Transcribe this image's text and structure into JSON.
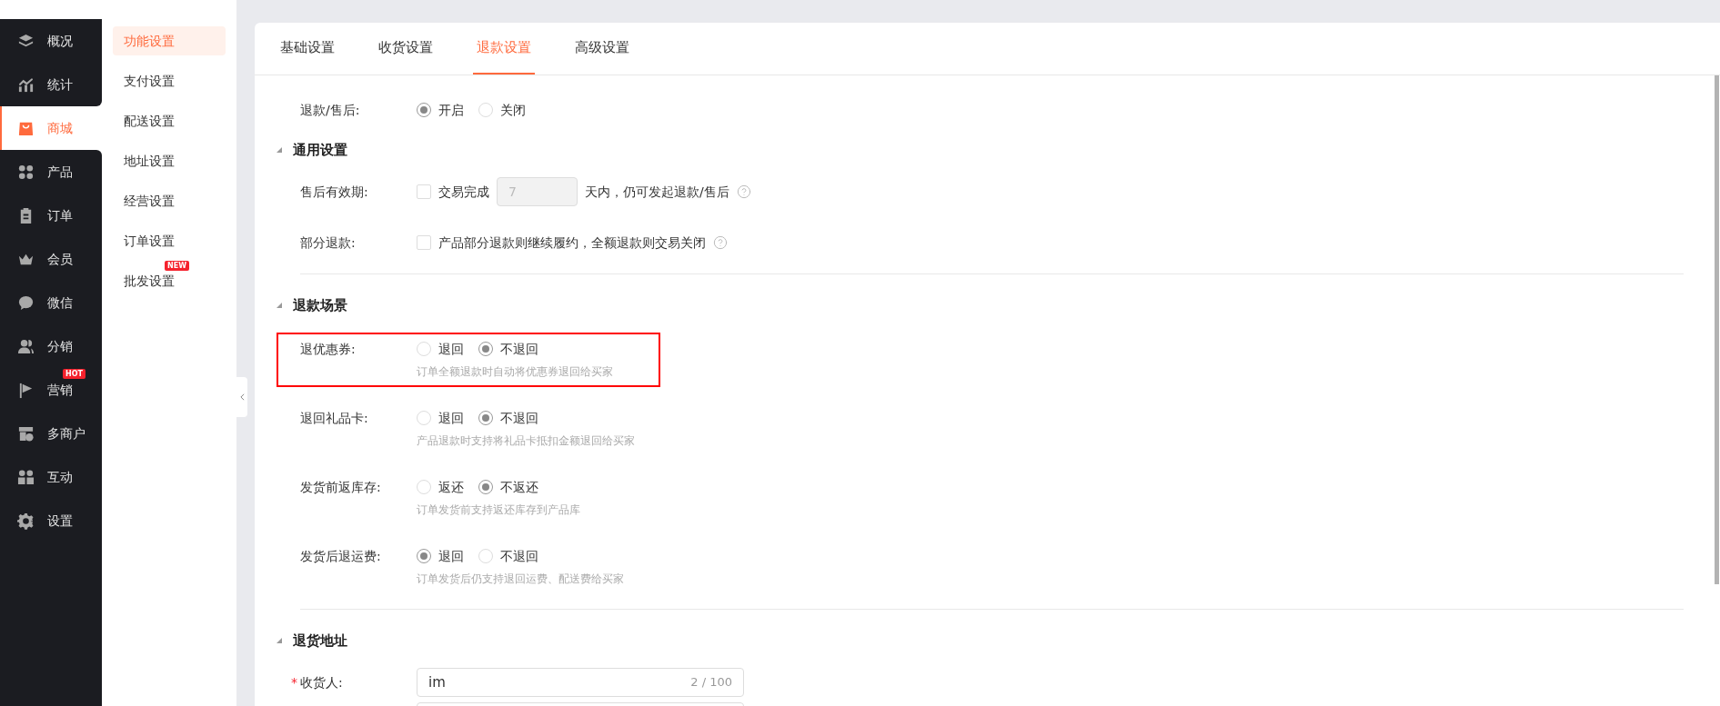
{
  "sidebar": {
    "items": [
      {
        "label": "概况",
        "selected": false
      },
      {
        "label": "统计",
        "selected": false
      },
      {
        "label": "商城",
        "selected": true
      },
      {
        "label": "产品",
        "selected": false
      },
      {
        "label": "订单",
        "selected": false
      },
      {
        "label": "会员",
        "selected": false
      },
      {
        "label": "微信",
        "selected": false
      },
      {
        "label": "分销",
        "selected": false
      },
      {
        "label": "营销",
        "selected": false,
        "badge": "HOT"
      },
      {
        "label": "多商户",
        "selected": false
      },
      {
        "label": "互动",
        "selected": false
      },
      {
        "label": "设置",
        "selected": false
      }
    ]
  },
  "submenu": {
    "items": [
      {
        "label": "功能设置",
        "selected": true
      },
      {
        "label": "支付设置",
        "selected": false
      },
      {
        "label": "配送设置",
        "selected": false
      },
      {
        "label": "地址设置",
        "selected": false
      },
      {
        "label": "经营设置",
        "selected": false
      },
      {
        "label": "订单设置",
        "selected": false
      },
      {
        "label": "批发设置",
        "selected": false,
        "badge": "NEW"
      }
    ]
  },
  "tabs": [
    {
      "label": "基础设置",
      "selected": false
    },
    {
      "label": "收货设置",
      "selected": false
    },
    {
      "label": "退款设置",
      "selected": true
    },
    {
      "label": "高级设置",
      "selected": false
    }
  ],
  "refund_toggle": {
    "label": "退款/售后:",
    "options": [
      {
        "label": "开启",
        "selected": true
      },
      {
        "label": "关闭",
        "selected": false
      }
    ]
  },
  "general": {
    "title": "通用设置",
    "after_sale_period": {
      "label": "售后有效期:",
      "checked": false,
      "prefix": "交易完成",
      "days": "7",
      "suffix": "天内，仍可发起退款/售后"
    },
    "partial_refund": {
      "label": "部分退款:",
      "checked": false,
      "text": "产品部分退款则继续履约，全额退款则交易关闭"
    }
  },
  "scenarios": {
    "title": "退款场景",
    "rows": [
      {
        "label": "退优惠券:",
        "highlighted": true,
        "options": [
          {
            "label": "退回",
            "selected": false
          },
          {
            "label": "不退回",
            "selected": true
          }
        ],
        "hint": "订单全额退款时自动将优惠券退回给买家"
      },
      {
        "label": "退回礼品卡:",
        "highlighted": false,
        "options": [
          {
            "label": "退回",
            "selected": false
          },
          {
            "label": "不退回",
            "selected": true
          }
        ],
        "hint": "产品退款时支持将礼品卡抵扣金额退回给买家"
      },
      {
        "label": "发货前返库存:",
        "highlighted": false,
        "options": [
          {
            "label": "返还",
            "selected": false
          },
          {
            "label": "不返还",
            "selected": true
          }
        ],
        "hint": "订单发货前支持返还库存到产品库"
      },
      {
        "label": "发货后退运费:",
        "highlighted": false,
        "options": [
          {
            "label": "退回",
            "selected": true
          },
          {
            "label": "不退回",
            "selected": false
          }
        ],
        "hint": "订单发货后仍支持退回运费、配送费给买家"
      }
    ]
  },
  "return_address": {
    "title": "退货地址",
    "receiver": {
      "label": "收货人:",
      "required_mark": "*",
      "value": "im",
      "counter": "2 / 100"
    }
  }
}
